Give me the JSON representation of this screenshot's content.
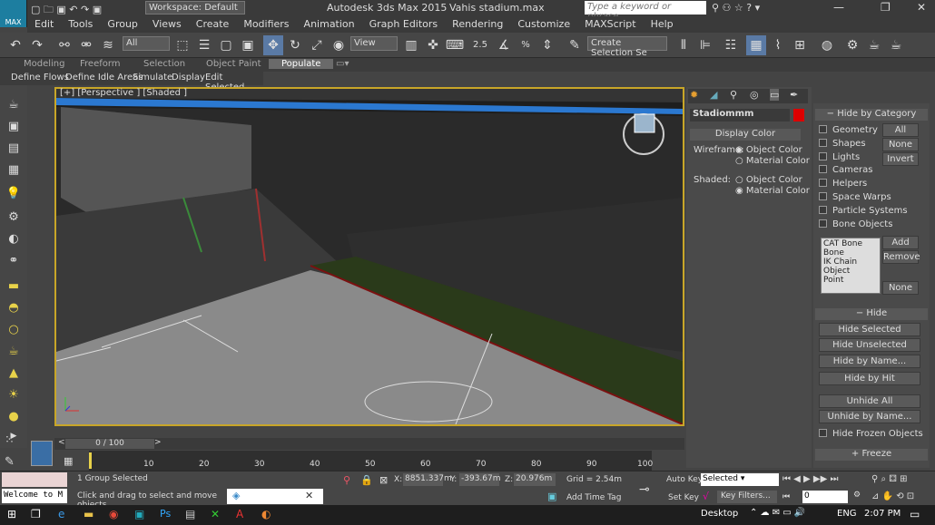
{
  "title": {
    "app": "Autodesk 3ds Max 2015",
    "file": "Vahis stadium.max",
    "workspace": "Workspace: Default",
    "search_placeholder": "Type a keyword or phrase"
  },
  "app_icon_label": "MAX",
  "menu": [
    "Edit",
    "Tools",
    "Group",
    "Views",
    "Create",
    "Modifiers",
    "Animation",
    "Graph Editors",
    "Rendering",
    "Customize",
    "MAXScript",
    "Help"
  ],
  "toolbar": {
    "filter": "All",
    "view": "View",
    "snap_angle": "2.5",
    "snap_pct": "%",
    "selection_set": "Create Selection Se"
  },
  "ribbon": {
    "tabs": [
      "Modeling",
      "Freeform",
      "Selection",
      "Object Paint",
      "Populate"
    ],
    "active": "Populate",
    "row": [
      "Define Flows",
      "Define Idle Areas",
      "Simulate",
      "Display",
      "Edit Selected"
    ]
  },
  "viewport": {
    "label": "[+] [Perspective ] [Shaded ]"
  },
  "cmdpanel": {
    "object_name": "Stadiommm",
    "display_color": "Display Color",
    "wireframe_label": "Wireframe:",
    "shaded_label": "Shaded:",
    "object_color": "Object Color",
    "material_color": "Material Color"
  },
  "hide_by_category": {
    "title": "Hide by Category",
    "items": [
      "Geometry",
      "Shapes",
      "Lights",
      "Cameras",
      "Helpers",
      "Space Warps",
      "Particle Systems",
      "Bone Objects"
    ],
    "all": "All",
    "none": "None",
    "invert": "Invert",
    "list": [
      "CAT Bone",
      "Bone",
      "IK Chain Object",
      "Point"
    ],
    "add": "Add",
    "remove": "Remove",
    "none2": "None"
  },
  "hide": {
    "title": "Hide",
    "buttons": [
      "Hide Selected",
      "Hide Unselected",
      "Hide by Name...",
      "Hide by Hit",
      "Unhide All",
      "Unhide by Name..."
    ],
    "frozen": "Hide Frozen Objects"
  },
  "freeze": "Freeze",
  "timeline": {
    "frame": "0 / 100",
    "ticks": [
      "10",
      "20",
      "30",
      "40",
      "50",
      "60",
      "70",
      "80",
      "90",
      "100"
    ]
  },
  "status": {
    "selection": "1 Group Selected",
    "prompt": "Click and drag to select and move objects",
    "welcome": "Welcome to M",
    "x": "8851.337m",
    "y": "-393.67m",
    "z": "20.976m",
    "grid": "Grid = 2.54m",
    "autokey": "Auto Key",
    "setkey": "Set Key",
    "key_mode": "Selected",
    "key_filters": "Key Filters...",
    "add_time_tag": "Add Time Tag",
    "frame_field": "0"
  },
  "taskbar": {
    "desktop": "Desktop",
    "lang": "ENG",
    "time": "2:07 PM"
  }
}
